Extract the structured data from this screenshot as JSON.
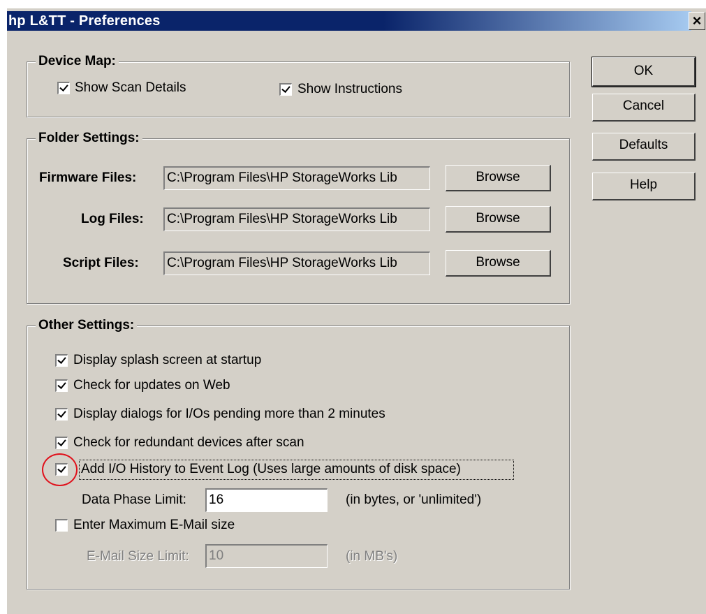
{
  "window": {
    "title": "hp L&TT - Preferences",
    "close_glyph": "×"
  },
  "buttons": {
    "ok": "OK",
    "cancel": "Cancel",
    "defaults": "Defaults",
    "help": "Help"
  },
  "device_map": {
    "title": "Device Map:",
    "show_scan_details": {
      "label": "Show Scan Details",
      "checked": true
    },
    "show_instructions": {
      "label": "Show Instructions",
      "checked": true
    }
  },
  "folder_settings": {
    "title": "Folder Settings:",
    "firmware": {
      "label": "Firmware Files:",
      "value": "C:\\Program Files\\HP StorageWorks Lib",
      "browse": "Browse"
    },
    "log": {
      "label": "Log Files:",
      "value": "C:\\Program Files\\HP StorageWorks Lib",
      "browse": "Browse"
    },
    "script": {
      "label": "Script Files:",
      "value": "C:\\Program Files\\HP StorageWorks Lib",
      "browse": "Browse"
    }
  },
  "other_settings": {
    "title": "Other Settings:",
    "splash": {
      "label": "Display splash screen at startup",
      "checked": true
    },
    "updates": {
      "label": "Check for updates on Web",
      "checked": true
    },
    "pending": {
      "label": "Display dialogs for I/Os pending more than 2 minutes",
      "checked": true
    },
    "redundant": {
      "label": "Check for redundant devices after scan",
      "checked": true
    },
    "io_history": {
      "label": "Add I/O History to Event Log  (Uses large amounts of disk space)",
      "checked": true
    },
    "data_phase": {
      "label": "Data Phase Limit:",
      "value": "16",
      "hint": "(in bytes, or 'unlimited')"
    },
    "max_email": {
      "label": "Enter Maximum E-Mail size",
      "checked": false
    },
    "email_limit": {
      "label": "E-Mail Size Limit:",
      "value": "10",
      "hint": "(in MB's)"
    }
  },
  "colors": {
    "dialog_bg": "#d4d0c8",
    "title_gradient_start": "#0a246a",
    "title_gradient_end": "#a6caf0",
    "annotation_circle": "#e0101b"
  }
}
